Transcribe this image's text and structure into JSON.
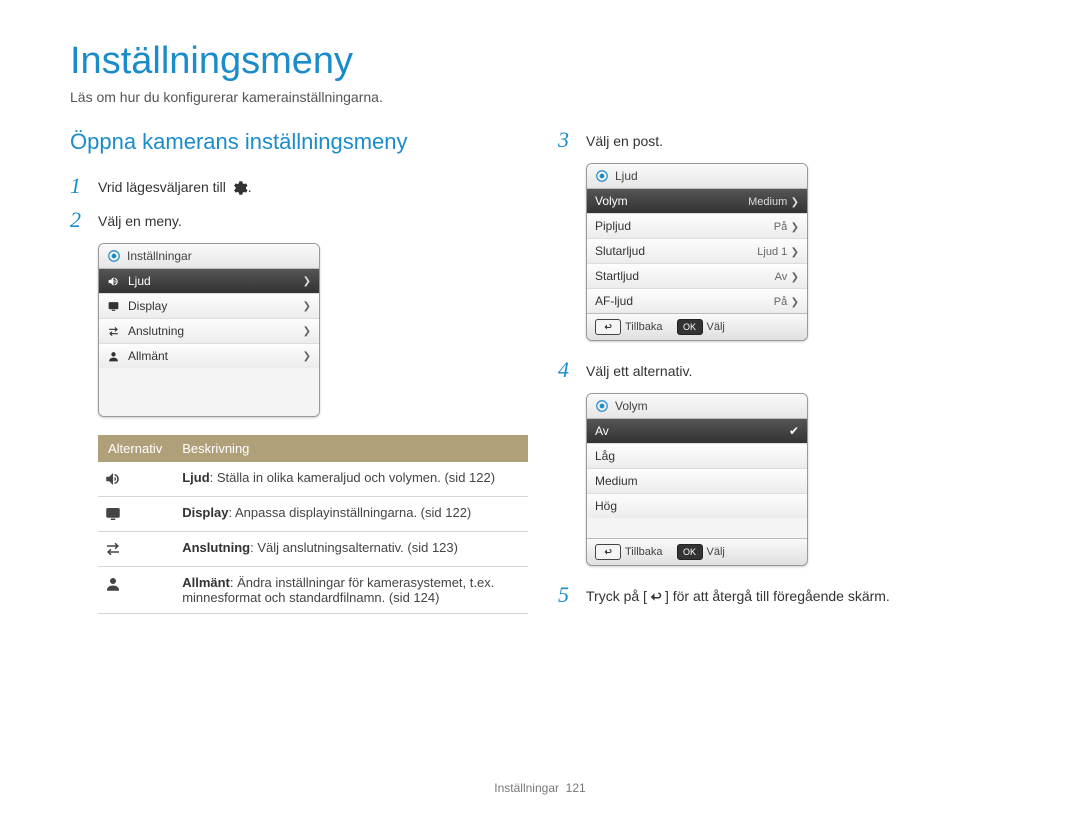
{
  "page": {
    "title": "Inställningsmeny",
    "intro": "Läs om hur du konfigurerar kamerainställningarna.",
    "footer_label": "Inställningar",
    "footer_page": "121"
  },
  "left": {
    "subheading": "Öppna kamerans inställningsmeny",
    "step1_num": "1",
    "step1_prefix": "Vrid lägesväljaren till ",
    "step1_suffix": ".",
    "step2_num": "2",
    "step2_text": "Välj en meny.",
    "screen1": {
      "title": "Inställningar",
      "items": [
        {
          "label": "Ljud",
          "icon": "speaker-icon",
          "selected": true
        },
        {
          "label": "Display",
          "icon": "screen-icon",
          "selected": false
        },
        {
          "label": "Anslutning",
          "icon": "arrows-icon",
          "selected": false
        },
        {
          "label": "Allmänt",
          "icon": "person-icon",
          "selected": false
        }
      ]
    },
    "table": {
      "header_option": "Alternativ",
      "header_desc": "Beskrivning",
      "rows": [
        {
          "icon": "speaker-icon",
          "title": "Ljud",
          "desc": ": Ställa in olika kameraljud och volymen. (sid 122)"
        },
        {
          "icon": "screen-icon",
          "title": "Display",
          "desc": ": Anpassa displayinställningarna. (sid 122)"
        },
        {
          "icon": "arrows-icon",
          "title": "Anslutning",
          "desc": ": Välj anslutningsalternativ. (sid 123)"
        },
        {
          "icon": "person-icon",
          "title": "Allmänt",
          "desc": ": Ändra inställningar för kamerasystemet, t.ex. minnesformat och standardfilnamn. (sid 124)"
        }
      ]
    }
  },
  "right": {
    "step3_num": "3",
    "step3_text": "Välj en post.",
    "screen2": {
      "title": "Ljud",
      "items": [
        {
          "label": "Volym",
          "value": "Medium",
          "selected": true
        },
        {
          "label": "Pipljud",
          "value": "På",
          "selected": false
        },
        {
          "label": "Slutarljud",
          "value": "Ljud 1",
          "selected": false
        },
        {
          "label": "Startljud",
          "value": "Av",
          "selected": false
        },
        {
          "label": "AF-ljud",
          "value": "På",
          "selected": false
        }
      ],
      "footer_back": "Tillbaka",
      "footer_select": "Välj",
      "ok_label": "OK"
    },
    "step4_num": "4",
    "step4_text": "Välj ett alternativ.",
    "screen3": {
      "title": "Volym",
      "items": [
        {
          "label": "Av",
          "selected": true
        },
        {
          "label": "Låg",
          "selected": false
        },
        {
          "label": "Medium",
          "selected": false
        },
        {
          "label": "Hög",
          "selected": false
        }
      ],
      "footer_back": "Tillbaka",
      "footer_select": "Välj",
      "ok_label": "OK"
    },
    "step5_num": "5",
    "step5_prefix": "Tryck på [",
    "step5_suffix": "] för att återgå till föregående skärm."
  }
}
